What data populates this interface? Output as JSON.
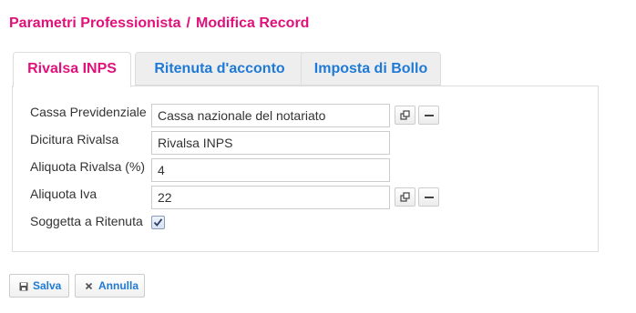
{
  "breadcrumb": {
    "parent": "Parametri Professionista",
    "separator": "/",
    "current": "Modifica Record"
  },
  "tabs": [
    {
      "label": "Rivalsa INPS",
      "active": true
    },
    {
      "label": "Ritenuta d'acconto",
      "active": false
    },
    {
      "label": "Imposta di Bollo",
      "active": false
    }
  ],
  "form": {
    "cassa_previdenziale": {
      "label": "Cassa Previdenziale",
      "value": "Cassa nazionale del notariato"
    },
    "dicitura_rivalsa": {
      "label": "Dicitura Rivalsa",
      "value": "Rivalsa INPS"
    },
    "aliquota_rivalsa": {
      "label": "Aliquota Rivalsa (%)",
      "value": "4"
    },
    "aliquota_iva": {
      "label": "Aliquota Iva",
      "value": "22"
    },
    "soggetta_ritenuta": {
      "label": "Soggetta a Ritenuta",
      "checked": true
    }
  },
  "actions": {
    "save_label": "Salva",
    "cancel_label": "Annulla"
  },
  "colors": {
    "accent": "#e0117b",
    "link": "#1f7ad6",
    "border": "#dddddd"
  },
  "icons": {
    "open": "open-lookup-icon",
    "clear": "minus-icon",
    "save": "floppy-disk-icon",
    "cancel": "close-icon",
    "check": "checkmark-icon"
  }
}
